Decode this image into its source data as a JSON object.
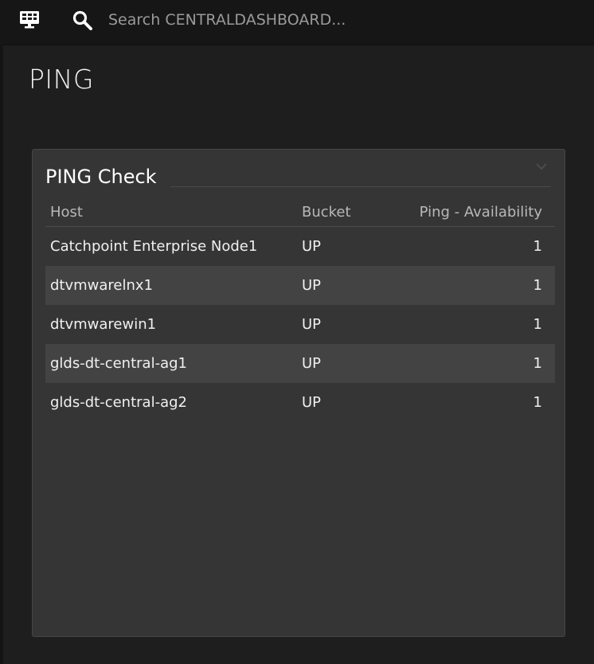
{
  "topbar": {
    "dashboard_icon": "dashboard-monitor-icon",
    "search_icon": "search-icon",
    "search_placeholder": "Search CENTRALDASHBOARD..."
  },
  "page": {
    "title": "PING"
  },
  "tile": {
    "title": "PING Check",
    "collapse_icon": "chevron-down-icon",
    "columns": [
      "Host",
      "Bucket",
      "Ping - Availability"
    ],
    "rows": [
      {
        "host": "Catchpoint Enterprise Node1",
        "bucket": "UP",
        "availability": "1"
      },
      {
        "host": "dtvmwarelnx1",
        "bucket": "UP",
        "availability": "1"
      },
      {
        "host": "dtvmwarewin1",
        "bucket": "UP",
        "availability": "1"
      },
      {
        "host": "glds-dt-central-ag1",
        "bucket": "UP",
        "availability": "1"
      },
      {
        "host": "glds-dt-central-ag2",
        "bucket": "UP",
        "availability": "1"
      }
    ]
  },
  "colors": {
    "background": "#1e1e1e",
    "topbar": "#161616",
    "tile": "#353535",
    "row_alt": "#434343"
  }
}
